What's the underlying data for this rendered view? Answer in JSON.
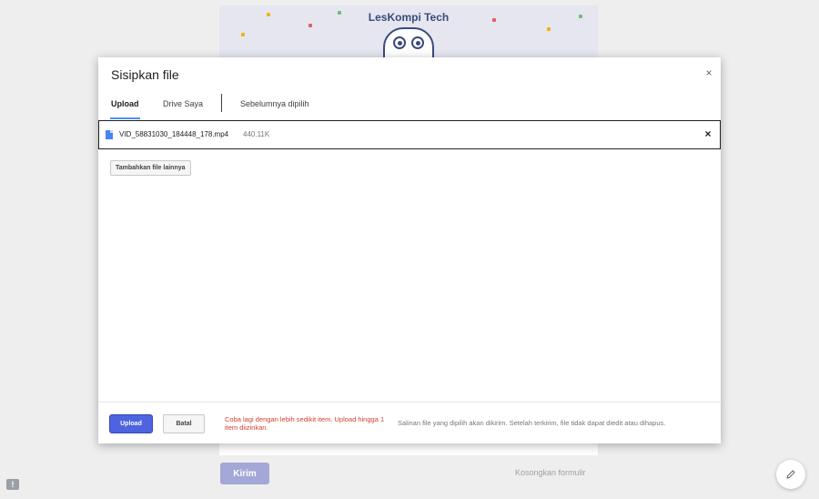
{
  "background": {
    "brand": "LesKompi Tech",
    "submit_label": "Kirim",
    "clear_label": "Kosongkan formulir",
    "feedback_icon": "!"
  },
  "dialog": {
    "title": "Sisipkan file",
    "close_glyph": "×",
    "tabs": [
      {
        "label": "Upload",
        "active": true
      },
      {
        "label": "Drive Saya",
        "active": false
      },
      {
        "label": "Sebelumnya dipilih",
        "active": false
      }
    ],
    "file": {
      "name": "VID_58831030_184448_178.mp4",
      "size": "440.11K",
      "remove_glyph": "×"
    },
    "add_more_label": "Tambahkan file lainnya",
    "footer": {
      "upload_label": "Upload",
      "cancel_label": "Batal",
      "error_text": "Coba lagi dengan lebih sedikit item. Upload hingga 1 item diizinkan.",
      "note_text": "Salinan file yang dipilih akan dikirim. Setelah terkirim, file tidak dapat diedit atau dihapus."
    }
  },
  "colors": {
    "accent": "#4d63e0",
    "tab_underline": "#4d90fe",
    "error": "#d23f31",
    "file_icon": "#4285f4"
  },
  "icons": [
    "file-icon",
    "close-icon",
    "remove-file-icon",
    "pencil-icon",
    "feedback-icon"
  ]
}
